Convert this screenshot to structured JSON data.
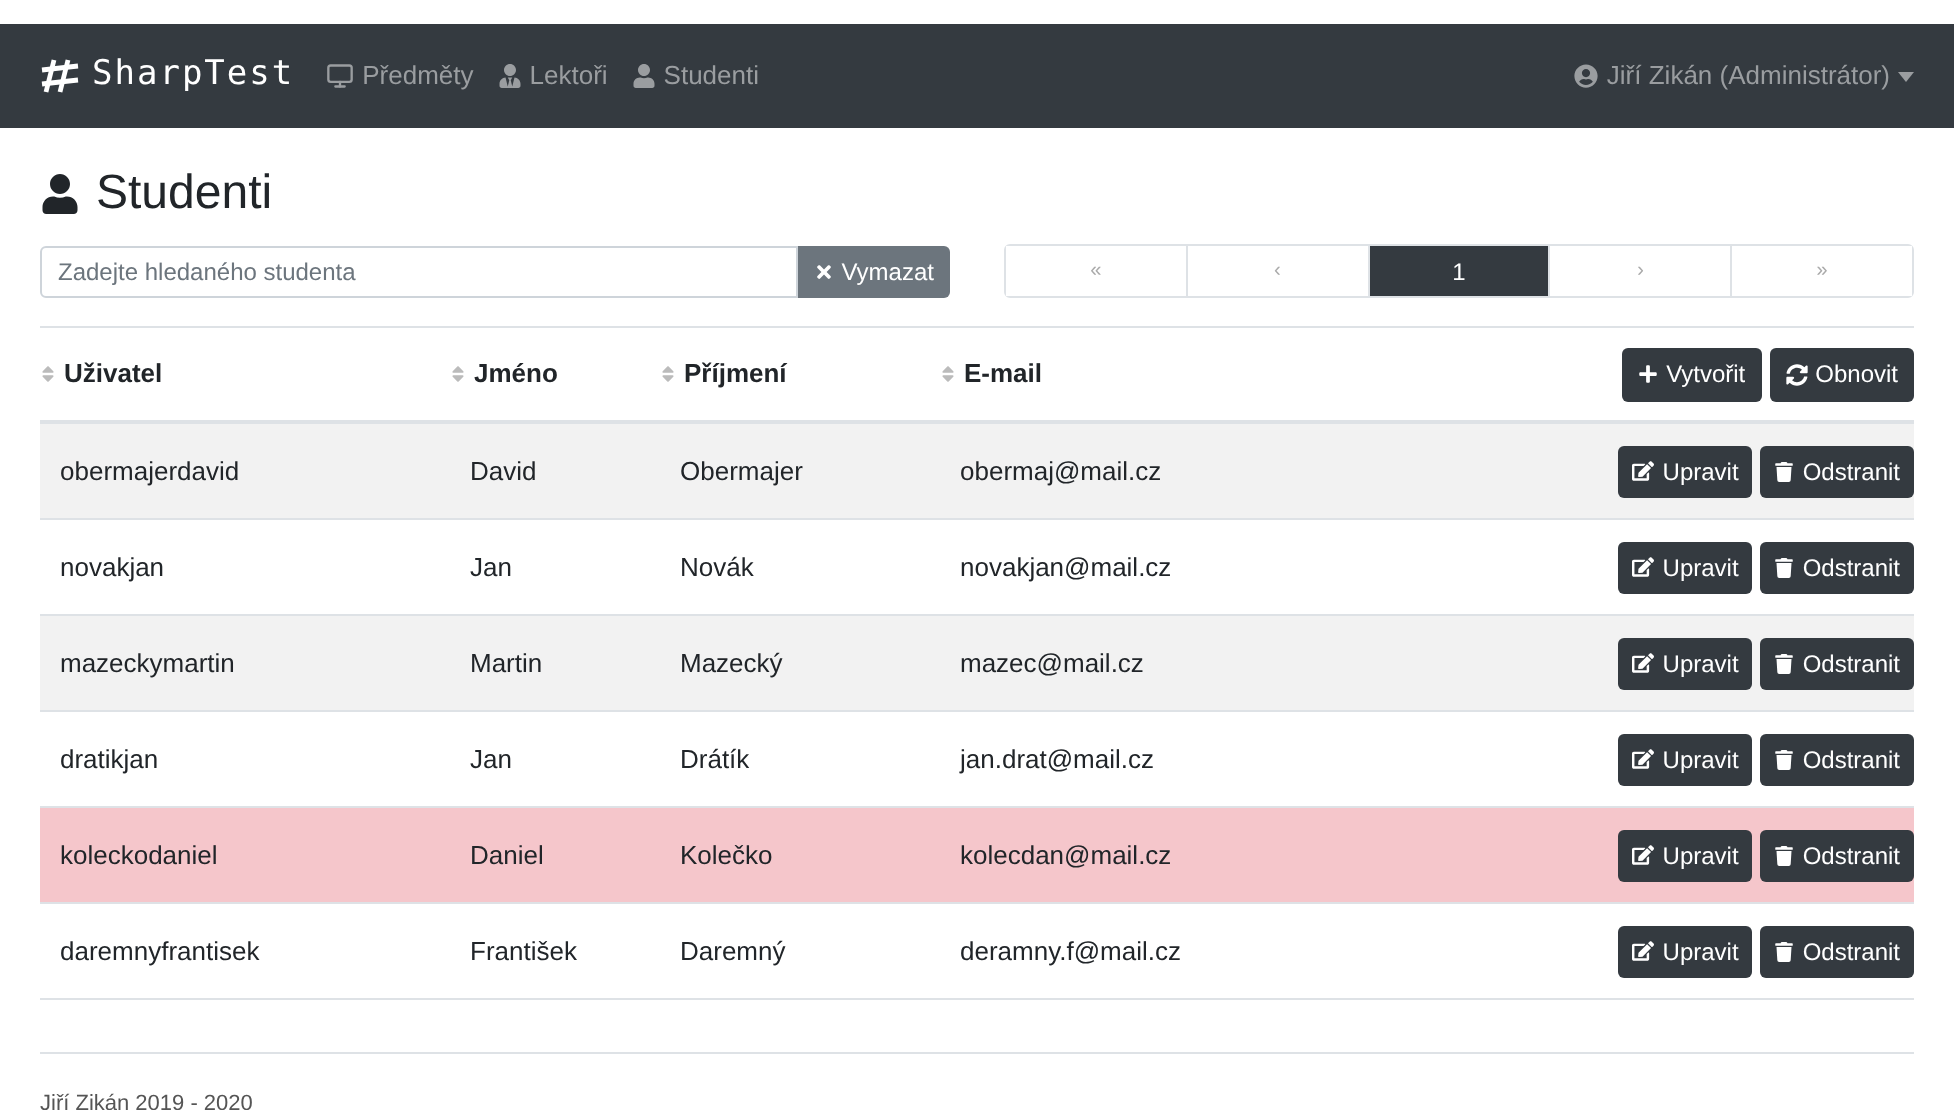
{
  "navbar": {
    "brand": "SharpTest",
    "links": [
      {
        "label": "Předměty",
        "kind": "subjects"
      },
      {
        "label": "Lektoři",
        "kind": "lecturers"
      },
      {
        "label": "Studenti",
        "kind": "students"
      }
    ],
    "user": "Jiří Zikán (Administrátor)"
  },
  "heading": "Studenti",
  "search": {
    "placeholder": "Zadejte hledaného studenta",
    "clear_button": "Vymazat"
  },
  "pagination": [
    {
      "label": "«",
      "selected": false
    },
    {
      "label": "‹",
      "selected": false
    },
    {
      "label": "1",
      "selected": true
    },
    {
      "label": "›",
      "selected": false
    },
    {
      "label": "»",
      "selected": false
    }
  ],
  "table": {
    "columns": [
      "Uživatel",
      "Jméno",
      "Příjmení",
      "E-mail"
    ],
    "create_button": "Vytvořit",
    "refresh_button": "Obnovit",
    "rows": [
      {
        "cells": [
          "obermajerdavid",
          "David",
          "Obermajer",
          "obermaj@mail.cz"
        ],
        "highlighted": false,
        "edit": "Upravit",
        "delete": "Odstranit"
      },
      {
        "cells": [
          "novakjan",
          "Jan",
          "Novák",
          "novakjan@mail.cz"
        ],
        "highlighted": false,
        "edit": "Upravit",
        "delete": "Odstranit"
      },
      {
        "cells": [
          "mazeckymartin",
          "Martin",
          "Mazecký",
          "mazec@mail.cz"
        ],
        "highlighted": false,
        "edit": "Upravit",
        "delete": "Odstranit"
      },
      {
        "cells": [
          "dratikjan",
          "Jan",
          "Drátík",
          "jan.drat@mail.cz"
        ],
        "highlighted": false,
        "edit": "Upravit",
        "delete": "Odstranit"
      },
      {
        "cells": [
          "koleckodaniel",
          "Daniel",
          "Kolečko",
          "kolecdan@mail.cz"
        ],
        "highlighted": true,
        "edit": "Upravit",
        "delete": "Odstranit"
      },
      {
        "cells": [
          "daremnyfrantisek",
          "František",
          "Daremný",
          "deramny.f@mail.cz"
        ],
        "highlighted": false,
        "edit": "Upravit",
        "delete": "Odstranit"
      }
    ]
  },
  "footer": "Jiří Zikán 2019 - 2020"
}
